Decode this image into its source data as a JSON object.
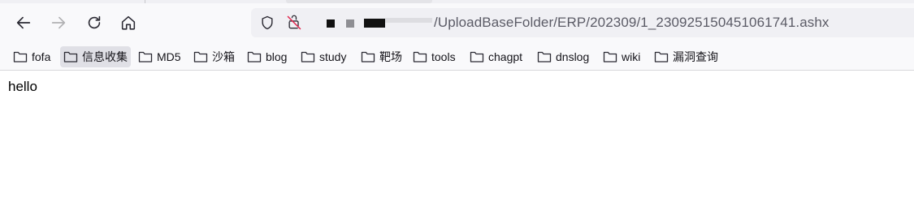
{
  "toolbar": {
    "back_icon": "arrow-left-icon",
    "forward_icon": "arrow-right-icon",
    "reload_icon": "reload-icon",
    "home_icon": "home-icon"
  },
  "urlbar": {
    "tracking_icon": "shield-icon",
    "permission_icon": "camera-blocked-icon",
    "host_redacted": true,
    "path": "/UploadBaseFolder/ERP/202309/1_230925150451061741.ashx"
  },
  "bookmarks": [
    {
      "label": "fofa",
      "icon": "folder-icon",
      "active": false
    },
    {
      "label": "信息收集",
      "icon": "folder-icon",
      "active": true
    },
    {
      "label": "MD5",
      "icon": "folder-icon",
      "active": false
    },
    {
      "label": "沙箱",
      "icon": "folder-icon",
      "active": false
    },
    {
      "label": "blog",
      "icon": "folder-icon",
      "active": false
    },
    {
      "label": "study",
      "icon": "folder-icon",
      "active": false
    },
    {
      "label": "靶场",
      "icon": "folder-icon",
      "active": false
    },
    {
      "label": "tools",
      "icon": "folder-icon",
      "active": false
    },
    {
      "label": "chagpt",
      "icon": "folder-icon",
      "active": false
    },
    {
      "label": "dnslog",
      "icon": "folder-icon",
      "active": false
    },
    {
      "label": "wiki",
      "icon": "folder-icon",
      "active": false
    },
    {
      "label": "漏洞查询",
      "icon": "folder-icon",
      "active": false
    }
  ],
  "page": {
    "body_text": "hello"
  },
  "colors": {
    "chrome_bg": "#f9f9fb",
    "urlbar_bg": "#f0f0f4",
    "active_bookmark_bg": "#e0e0e6",
    "url_text": "#5b5b66",
    "permission_icon_accent": "#e22850"
  }
}
